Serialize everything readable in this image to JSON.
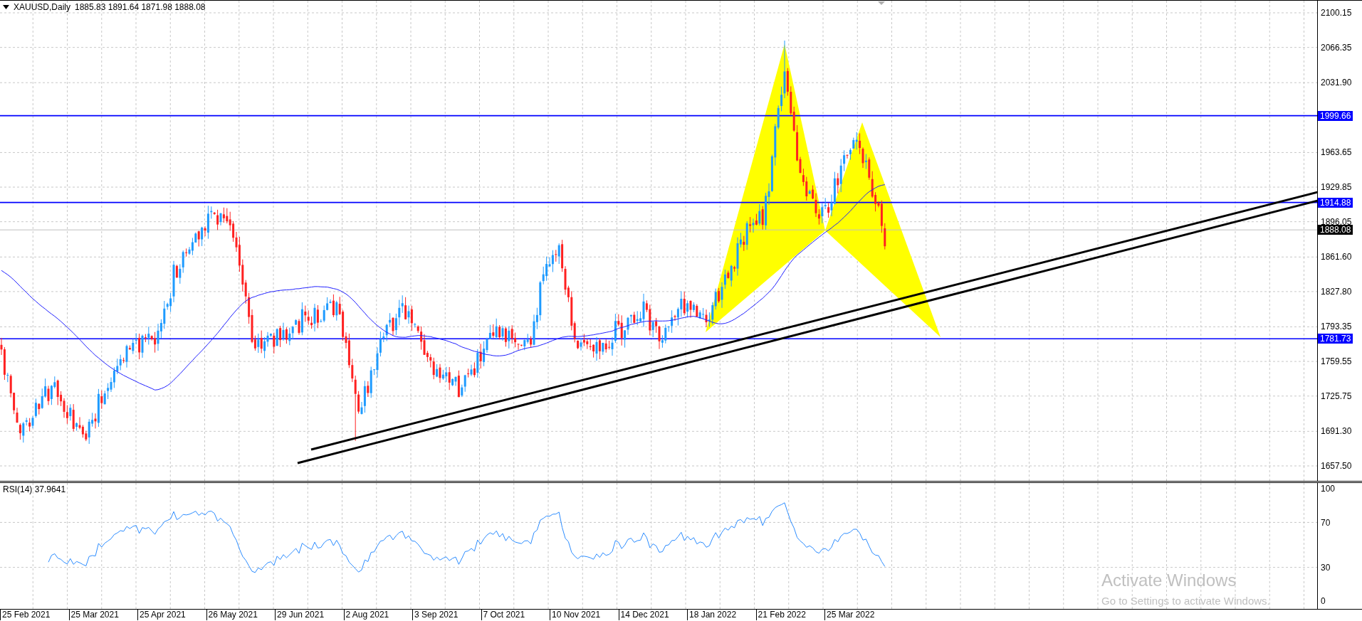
{
  "chart": {
    "symbol": "XAUUSD,Daily",
    "ohlc": "1885.83 1891.64 1871.98 1888.08"
  },
  "price_axis": {
    "ticks": [
      "2100.15",
      "2066.35",
      "2031.90",
      "1963.65",
      "1929.85",
      "1896.05",
      "1861.60",
      "1827.80",
      "1793.35",
      "1759.55",
      "1725.75",
      "1691.30",
      "1657.50"
    ]
  },
  "levels": [
    {
      "label": "1999.66",
      "kind": "level"
    },
    {
      "label": "1914.88",
      "kind": "level"
    },
    {
      "label": "1888.08",
      "kind": "bid"
    },
    {
      "label": "1781.73",
      "kind": "level"
    }
  ],
  "indicator": {
    "label": "RSI(14) 37.9641",
    "ticks": [
      "100",
      "70",
      "30",
      "0"
    ]
  },
  "time_axis": {
    "ticks": [
      "25 Feb 2021",
      "25 Mar 2021",
      "25 Apr 2021",
      "26 May 2021",
      "29 Jun 2021",
      "2 Aug 2021",
      "3 Sep 2021",
      "7 Oct 2021",
      "10 Nov 2021",
      "14 Dec 2021",
      "18 Jan 2022",
      "21 Feb 2022",
      "25 Mar 2022"
    ]
  },
  "os_notice": {
    "title": "Activate Windows",
    "text": "Go to Settings to activate Windows."
  }
}
